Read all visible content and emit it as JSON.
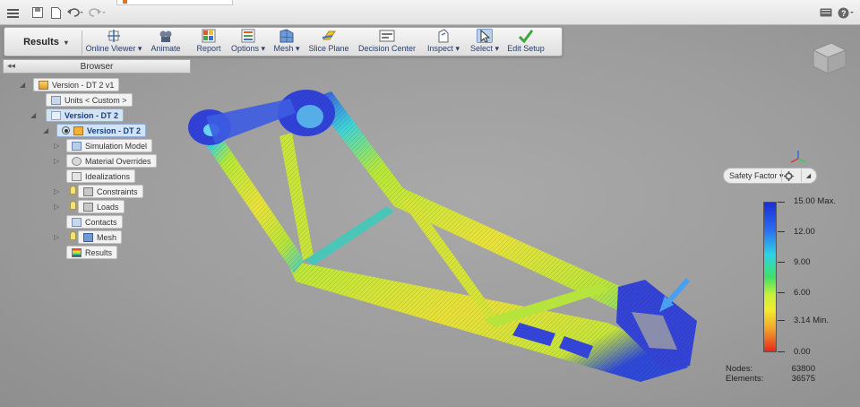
{
  "titlebar": {
    "icons": [
      "menu-icon",
      "save-icon",
      "file-icon",
      "undo-icon",
      "redo-icon",
      "chat-icon",
      "help-icon"
    ]
  },
  "toolbar": {
    "workspace_label": "Results",
    "tools": [
      {
        "label": "Online Viewer ▾",
        "icon": "online-viewer-icon"
      },
      {
        "label": "Animate",
        "icon": "animate-icon"
      },
      {
        "label": "Report",
        "icon": "report-icon"
      },
      {
        "label": "Options ▾",
        "icon": "options-icon"
      },
      {
        "label": "Mesh ▾",
        "icon": "mesh-icon"
      },
      {
        "label": "Slice Plane",
        "icon": "slice-plane-icon"
      },
      {
        "label": "Decision Center",
        "icon": "decision-center-icon"
      },
      {
        "label": "Inspect ▾",
        "icon": "inspect-icon"
      },
      {
        "label": "Select ▾",
        "icon": "select-icon"
      },
      {
        "label": "Edit Setup",
        "icon": "edit-setup-icon"
      }
    ]
  },
  "browser": {
    "title": "Browser",
    "nodes": [
      {
        "label": "Version - DT 2 v1"
      },
      {
        "label": "Units < Custom >"
      },
      {
        "label": "Version - DT 2"
      },
      {
        "label": "Version - DT 2"
      },
      {
        "label": "Simulation Model"
      },
      {
        "label": "Material Overrides"
      },
      {
        "label": "Idealizations"
      },
      {
        "label": "Constraints"
      },
      {
        "label": "Loads"
      },
      {
        "label": "Contacts"
      },
      {
        "label": "Mesh"
      },
      {
        "label": "Results"
      }
    ]
  },
  "legend": {
    "result_type": "Safety Factor ▾",
    "max_label": "15.00 Max.",
    "labels": [
      "12.00",
      "9.00",
      "6.00"
    ],
    "min_label": "3.14 Min.",
    "zero_label": "0.00",
    "colors": [
      "#1a2ed6",
      "#2fd2e6",
      "#3ee06a",
      "#f2ec2e",
      "#e8281e"
    ]
  },
  "stats": {
    "nodes_label": "Nodes:",
    "nodes_value": "63800",
    "elements_label": "Elements:",
    "elements_value": "36575"
  }
}
